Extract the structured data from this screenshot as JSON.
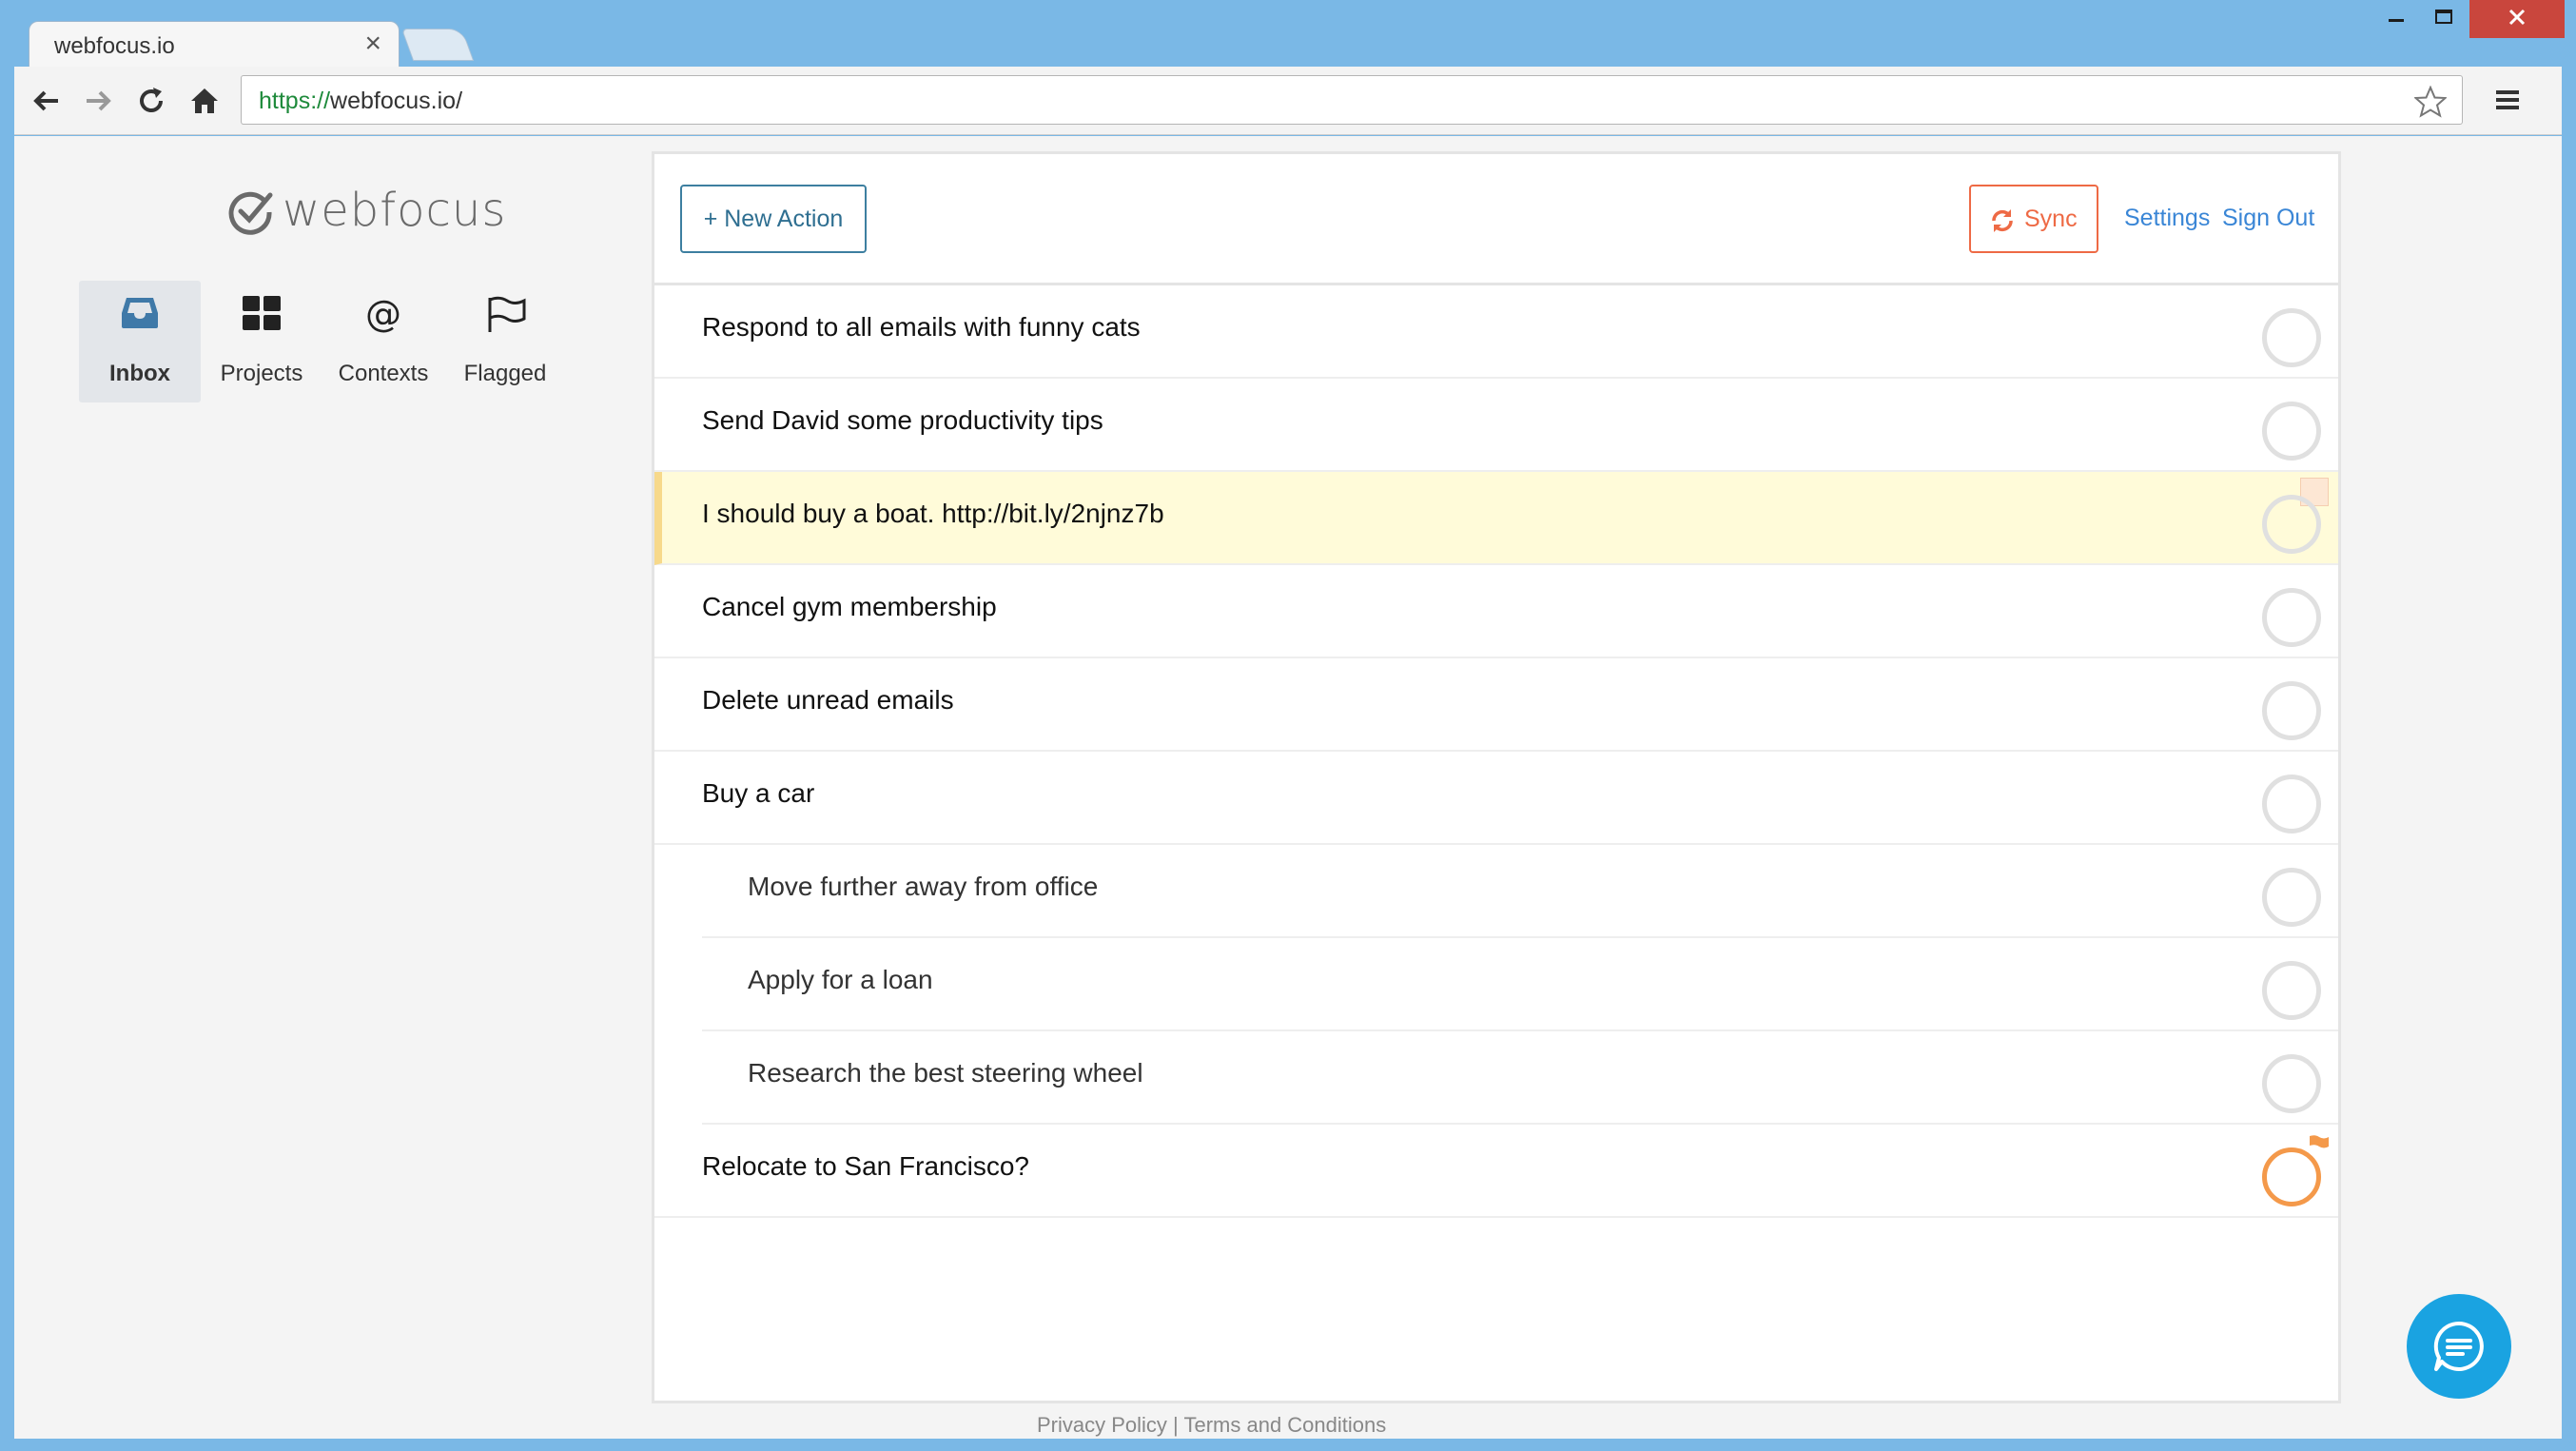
{
  "browser": {
    "tab_title": "webfocus.io",
    "tab_close": "×",
    "url_scheme": "https://",
    "url_rest": "webfocus.io/"
  },
  "app": {
    "logo_text": "webfocus",
    "nav": [
      {
        "label": "Inbox",
        "icon": "inbox-icon",
        "active": true
      },
      {
        "label": "Projects",
        "icon": "grid-icon",
        "active": false
      },
      {
        "label": "Contexts",
        "icon": "at-icon",
        "active": false
      },
      {
        "label": "Flagged",
        "icon": "flag-icon",
        "active": false
      }
    ],
    "contexts_glyph": "@"
  },
  "header": {
    "new_action_label": "+ New Action",
    "sync_label": "Sync",
    "settings_label": "Settings",
    "signout_label": "Sign Out"
  },
  "tasks": [
    {
      "text": "Respond to all emails with funny cats",
      "sub": false,
      "highlight": false,
      "flagged": false
    },
    {
      "text": "Send David some productivity tips",
      "sub": false,
      "highlight": false,
      "flagged": false
    },
    {
      "text": "I should buy a boat. http://bit.ly/2njnz7b",
      "sub": false,
      "highlight": true,
      "flagged": false
    },
    {
      "text": "Cancel gym membership",
      "sub": false,
      "highlight": false,
      "flagged": false
    },
    {
      "text": "Delete unread emails",
      "sub": false,
      "highlight": false,
      "flagged": false
    },
    {
      "text": "Buy a car",
      "sub": false,
      "highlight": false,
      "flagged": false
    },
    {
      "text": "Move further away from office",
      "sub": true,
      "highlight": false,
      "flagged": false
    },
    {
      "text": "Apply for a loan",
      "sub": true,
      "highlight": false,
      "flagged": false
    },
    {
      "text": "Research the best steering wheel",
      "sub": true,
      "highlight": false,
      "flagged": false
    },
    {
      "text": "Relocate to San Francisco?",
      "sub": false,
      "highlight": false,
      "flagged": true
    }
  ],
  "footer": {
    "privacy": "Privacy Policy",
    "separator": " | ",
    "terms": "Terms and Conditions"
  },
  "colors": {
    "accent_blue": "#3a86d6",
    "sync_orange": "#ee6a45",
    "flag_orange": "#f4994a",
    "highlight_bg": "#fffbd9",
    "chat_blue": "#1aa3e1"
  }
}
